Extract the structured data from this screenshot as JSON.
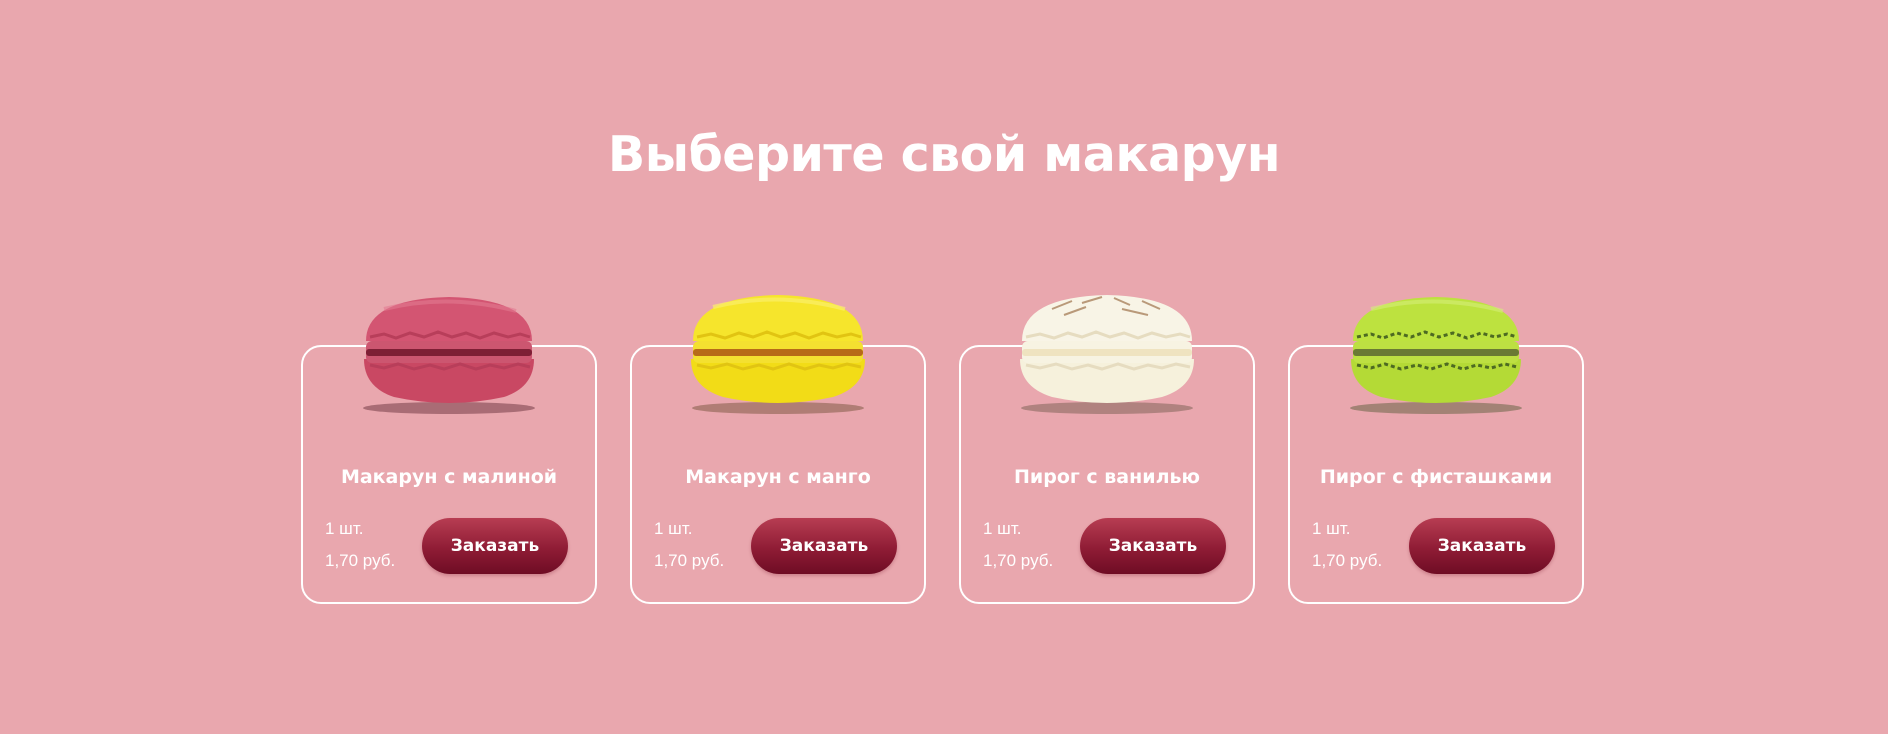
{
  "title": "Выберите свой макарун",
  "products": [
    {
      "name": "Макарун с малиной",
      "qty": "1 шт.",
      "price": "1,70 руб.",
      "button": "Заказать",
      "flavor": "raspberry",
      "color": "#d6506e"
    },
    {
      "name": "Макарун с манго",
      "qty": "1 шт.",
      "price": "1,70 руб.",
      "button": "Заказать",
      "flavor": "mango",
      "color": "#f4df1c"
    },
    {
      "name": "Пирог с ванилью",
      "qty": "1 шт.",
      "price": "1,70 руб.",
      "button": "Заказать",
      "flavor": "vanilla",
      "color": "#f5f0dc"
    },
    {
      "name": "Пирог с фисташками",
      "qty": "1 шт.",
      "price": "1,70 руб.",
      "button": "Заказать",
      "flavor": "pistachio",
      "color": "#b6dc3a"
    }
  ],
  "colors": {
    "background": "#e9a7ae",
    "button": "#8f1c35",
    "text": "#ffffff"
  }
}
